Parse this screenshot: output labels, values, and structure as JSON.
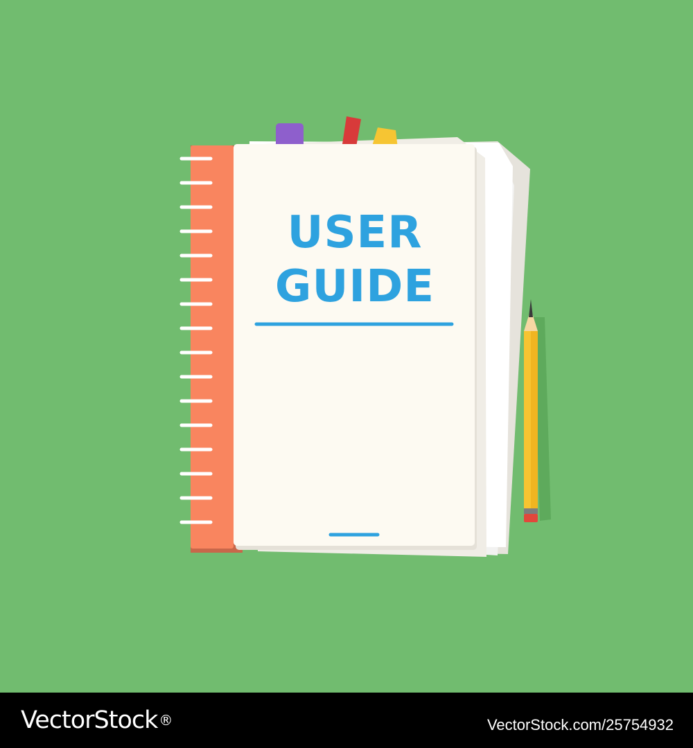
{
  "cover": {
    "line1": "USER",
    "line2": "GUIDE"
  },
  "footer": {
    "brand": "VectorStock",
    "brand_mark": "®",
    "image_id": "VectorStock.com/25754932"
  },
  "colors": {
    "background": "#71bc6f",
    "binder_spine": "#f9855f",
    "page": "#fdfaf2",
    "title_blue": "#2ea2df",
    "tab_purple": "#8e5fcc",
    "tab_red": "#d83a3a",
    "tab_yellow": "#f6c533",
    "pencil": "#f7c431",
    "footer_bg": "#000000"
  },
  "icons": [
    "spiral-ring-icon",
    "bookmark-tab-icon",
    "pencil-icon"
  ]
}
